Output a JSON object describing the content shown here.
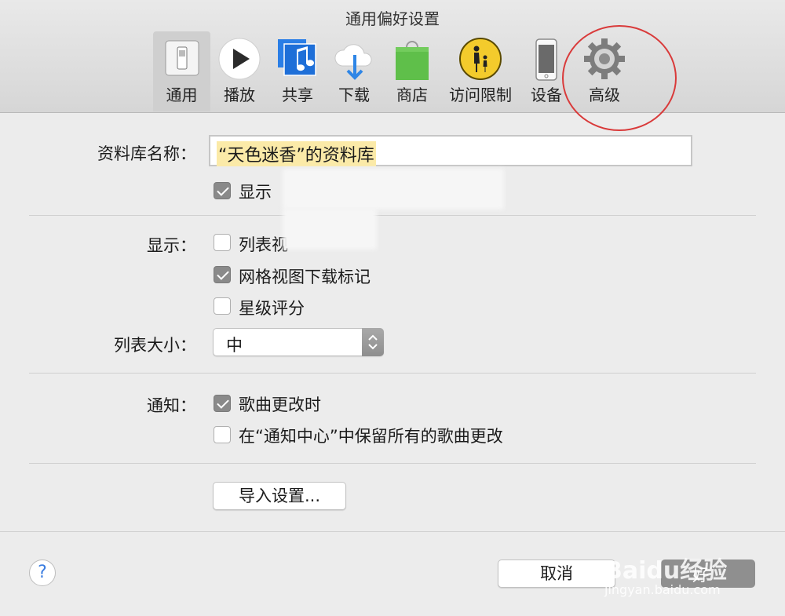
{
  "window": {
    "title": "通用偏好设置"
  },
  "toolbar": {
    "tabs": [
      {
        "label": "通用",
        "icon": "switch-icon"
      },
      {
        "label": "播放",
        "icon": "play-icon"
      },
      {
        "label": "共享",
        "icon": "music-share-icon"
      },
      {
        "label": "下载",
        "icon": "cloud-download-icon"
      },
      {
        "label": "商店",
        "icon": "shopping-bag-icon"
      },
      {
        "label": "访问限制",
        "icon": "parental-icon"
      },
      {
        "label": "设备",
        "icon": "phone-icon"
      },
      {
        "label": "高级",
        "icon": "gear-icon"
      }
    ],
    "selected": "通用"
  },
  "library": {
    "label": "资料库名称：",
    "value": "“天色迷香”的资料库"
  },
  "show_option": {
    "label": "显示",
    "checked": true
  },
  "display": {
    "label": "显示：",
    "options": [
      {
        "label": "列表视",
        "checked": false
      },
      {
        "label": "网格视图下载标记",
        "checked": true
      },
      {
        "label": "星级评分",
        "checked": false
      }
    ]
  },
  "list_size": {
    "label": "列表大小：",
    "value": "中"
  },
  "notify": {
    "label": "通知：",
    "options": [
      {
        "label": "歌曲更改时",
        "checked": true
      },
      {
        "label": "在“通知中心”中保留所有的歌曲更改",
        "checked": false
      }
    ]
  },
  "import_button": "导入设置...",
  "help": "?",
  "cancel_button": "取消",
  "ok_button": "好",
  "watermark": {
    "text": "Baidu经验",
    "sub": "jingyan.baidu.com"
  },
  "colors": {
    "highlight": "#fbeaa8",
    "checked": "#8a8a8a",
    "annotation": "#d93a3a"
  }
}
